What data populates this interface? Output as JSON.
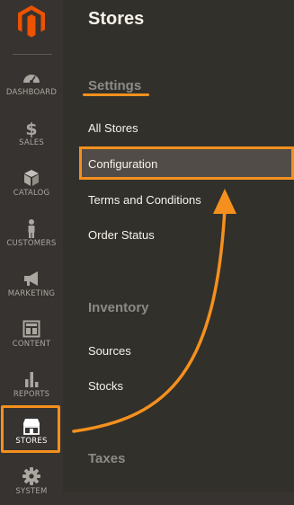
{
  "sidebar": {
    "logo_icon": "magento-logo-icon",
    "items": [
      {
        "label": "DASHBOARD",
        "icon": "speedometer-icon",
        "active": false
      },
      {
        "label": "SALES",
        "icon": "dollar-icon",
        "active": false
      },
      {
        "label": "CATALOG",
        "icon": "cube-icon",
        "active": false
      },
      {
        "label": "CUSTOMERS",
        "icon": "person-icon",
        "active": false
      },
      {
        "label": "MARKETING",
        "icon": "megaphone-icon",
        "active": false
      },
      {
        "label": "CONTENT",
        "icon": "layout-icon",
        "active": false
      },
      {
        "label": "REPORTS",
        "icon": "bar-chart-icon",
        "active": false
      },
      {
        "label": "STORES",
        "icon": "storefront-icon",
        "active": true
      },
      {
        "label": "SYSTEM",
        "icon": "gear-icon",
        "active": false
      }
    ]
  },
  "panel": {
    "title": "Stores",
    "sections": [
      {
        "title": "Settings",
        "links": [
          "All Stores",
          "Configuration",
          "Terms and Conditions",
          "Order Status"
        ]
      },
      {
        "title": "Inventory",
        "links": [
          "Sources",
          "Stocks"
        ]
      },
      {
        "title": "Taxes",
        "links": []
      }
    ]
  },
  "colors": {
    "accent": "#f5901e",
    "sidebar_bg": "#373330",
    "panel_bg": "#31302b",
    "logo": "#eb5202"
  }
}
